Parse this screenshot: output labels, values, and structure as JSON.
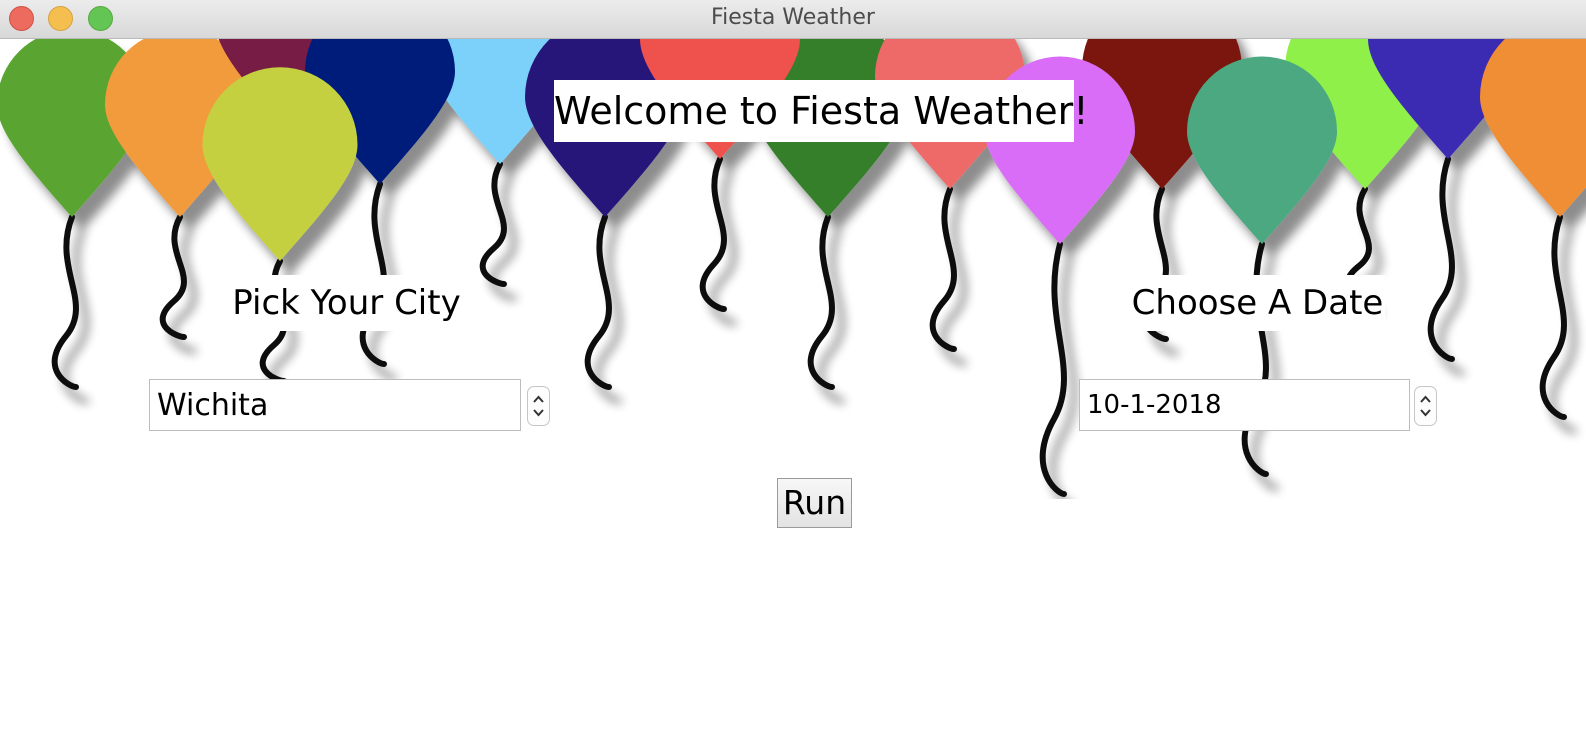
{
  "window": {
    "title": "Fiesta Weather"
  },
  "header": {
    "welcome": "Welcome to Fiesta Weather!"
  },
  "city": {
    "label": "Pick Your City",
    "value": "Wichita"
  },
  "date": {
    "label": "Choose A Date",
    "value": "10-1-2018"
  },
  "actions": {
    "run_label": "Run"
  },
  "icons": {
    "close": "close-traffic-light",
    "minimize": "minimize-traffic-light",
    "maximize": "maximize-traffic-light",
    "stepper": "up-down-chevron-icon"
  },
  "colors": {
    "balloons": [
      "#5aa532",
      "#f29b3c",
      "#771d45",
      "#7cd1fb",
      "#28197a",
      "#347f2c",
      "#ee6a69",
      "#7a1710",
      "#8ef04a",
      "#3b29b2",
      "#f08e34",
      "#ef514d",
      "#021e7a",
      "#c4d040",
      "#da6df7",
      "#4ba880"
    ]
  }
}
